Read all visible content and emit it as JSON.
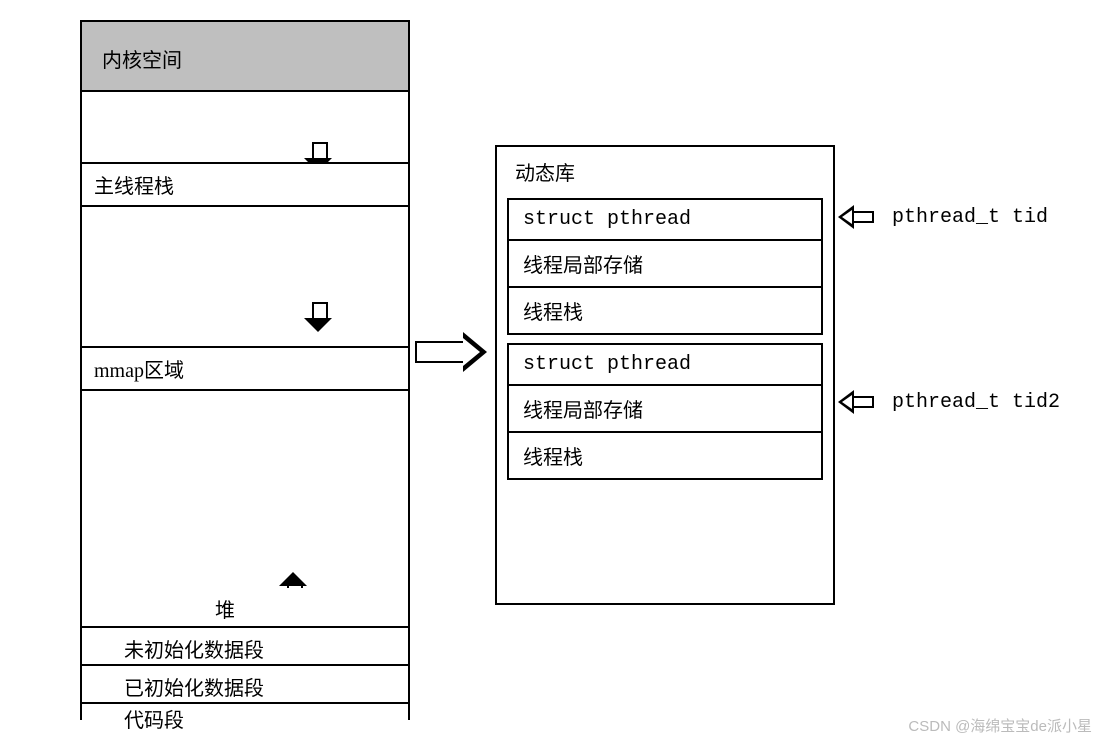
{
  "left": {
    "kernel": "内核空间",
    "main_stack": "主线程栈",
    "mmap": "mmap区域",
    "heap": "堆",
    "bss": "未初始化数据段",
    "data": "已初始化数据段",
    "text": "代码段"
  },
  "right": {
    "title": "动态库",
    "tcb": {
      "struct": "struct pthread",
      "tls": "线程局部存储",
      "stack": "线程栈"
    }
  },
  "pointers": {
    "tid1": "pthread_t tid",
    "tid2": "pthread_t tid2"
  },
  "watermark": "CSDN @海绵宝宝de派小星"
}
